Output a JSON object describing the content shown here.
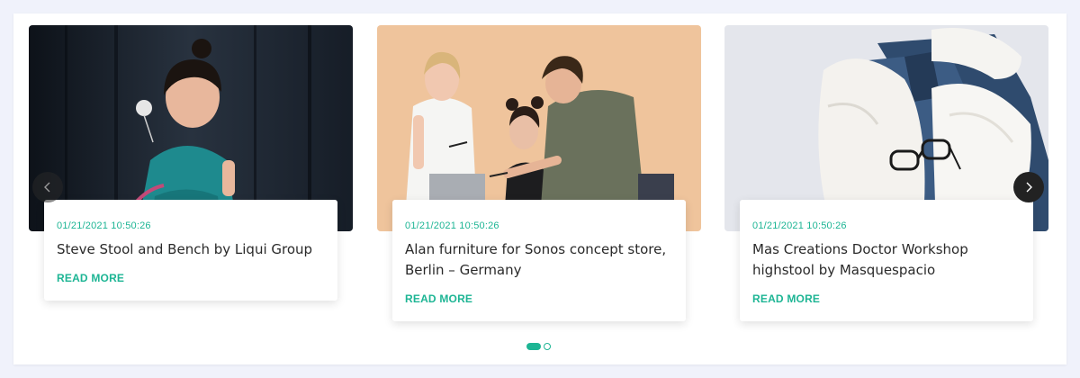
{
  "colors": {
    "accent": "#1db594",
    "page_bg": "#f0f2fb",
    "title_text": "#2a2a2a"
  },
  "carousel": {
    "prev_icon": "chevron-left-icon",
    "next_icon": "chevron-right-icon",
    "pagination": {
      "total": 2,
      "active": 1
    },
    "posts": [
      {
        "image": "girl-with-dandelion-photo",
        "date": "01/21/2021 10:50:26",
        "title": "Steve Stool and Bench by Liqui Group",
        "link": "READ MORE"
      },
      {
        "image": "office-team-at-laptop-photo",
        "date": "01/21/2021 10:50:26",
        "title": "Alan furniture for Sonos concept store, Berlin – Germany",
        "link": "READ MORE"
      },
      {
        "image": "knitwear-and-jeans-with-glasses-photo",
        "date": "01/21/2021 10:50:26",
        "title": "Mas Creations Doctor Workshop highstool by Masquespacio",
        "link": "READ MORE"
      }
    ]
  }
}
